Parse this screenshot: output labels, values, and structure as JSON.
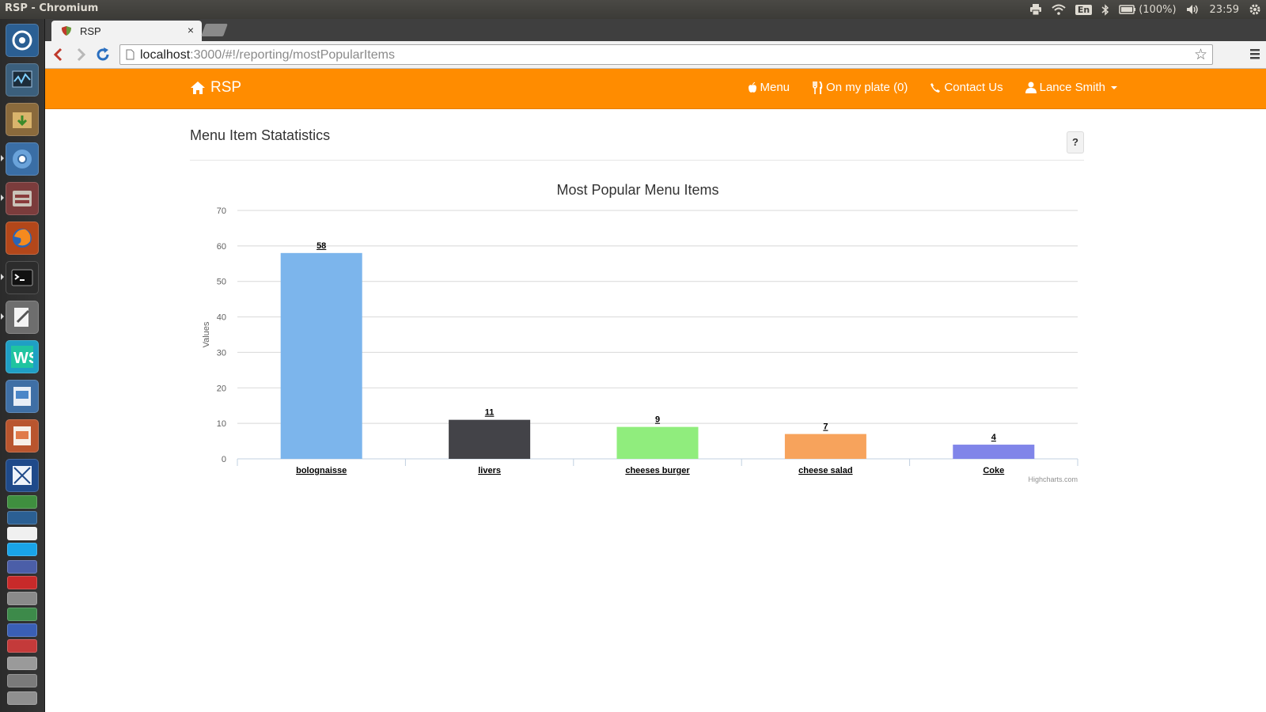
{
  "os": {
    "window_title": "RSP - Chromium",
    "keyboard_layout": "En",
    "battery": "(100%)",
    "clock": "23:59"
  },
  "browser": {
    "tab_title": "RSP",
    "tab_close": "×",
    "url_host": "localhost",
    "url_path": ":3000/#!/reporting/mostPopularItems",
    "bookmark_star": "☆"
  },
  "app": {
    "brand": "RSP",
    "nav": {
      "menu": "Menu",
      "plate": "On my plate (0)",
      "contact": "Contact Us",
      "user": "Lance Smith"
    },
    "accent_color": "#ff8c00"
  },
  "page": {
    "title": "Menu Item Statatistics",
    "help": "?"
  },
  "chart_data": {
    "type": "bar",
    "title": "Most Popular Menu Items",
    "xlabel": "",
    "ylabel": "Values",
    "ylim": [
      0,
      70
    ],
    "yticks": [
      0,
      10,
      20,
      30,
      40,
      50,
      60,
      70
    ],
    "categories": [
      "bolognaisse",
      "livers",
      "cheeses burger",
      "cheese salad",
      "Coke"
    ],
    "values": [
      58,
      11,
      9,
      7,
      4
    ],
    "colors": [
      "#7cb5ec",
      "#434348",
      "#90ed7d",
      "#f7a35c",
      "#8085e9"
    ],
    "grid": true,
    "legend": "none",
    "credits": "Highcharts.com"
  }
}
